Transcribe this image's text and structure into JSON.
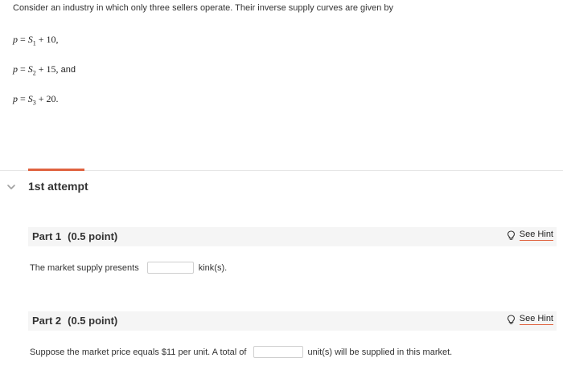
{
  "intro": "Consider an industry in which only three sellers operate. Their inverse supply curves are given by",
  "equations": [
    {
      "lhs": "p",
      "eq": " = ",
      "var": "S",
      "sub": "1",
      "rest": " + 10,",
      "suffix": ""
    },
    {
      "lhs": "p",
      "eq": " = ",
      "var": "S",
      "sub": "2",
      "rest": " + 15,",
      "suffix": " and"
    },
    {
      "lhs": "p",
      "eq": " = ",
      "var": "S",
      "sub": "3",
      "rest": " + 20.",
      "suffix": ""
    }
  ],
  "attempt": {
    "title": "1st attempt"
  },
  "parts": [
    {
      "label": "Part 1",
      "points": "(0.5 point)",
      "hint": "See Hint",
      "question_before": "The market supply presents",
      "question_after": "kink(s).",
      "input_value": ""
    },
    {
      "label": "Part 2",
      "points": "(0.5 point)",
      "hint": "See Hint",
      "question_before": "Suppose the market price equals $11 per unit. A total of",
      "question_after": "unit(s) will be supplied in this market.",
      "input_value": ""
    }
  ],
  "icons": {
    "collapse": "chevron-down-icon",
    "hint": "lightbulb-icon"
  },
  "colors": {
    "accent": "#e0623f",
    "part_header_bg": "#f5f5f5"
  }
}
